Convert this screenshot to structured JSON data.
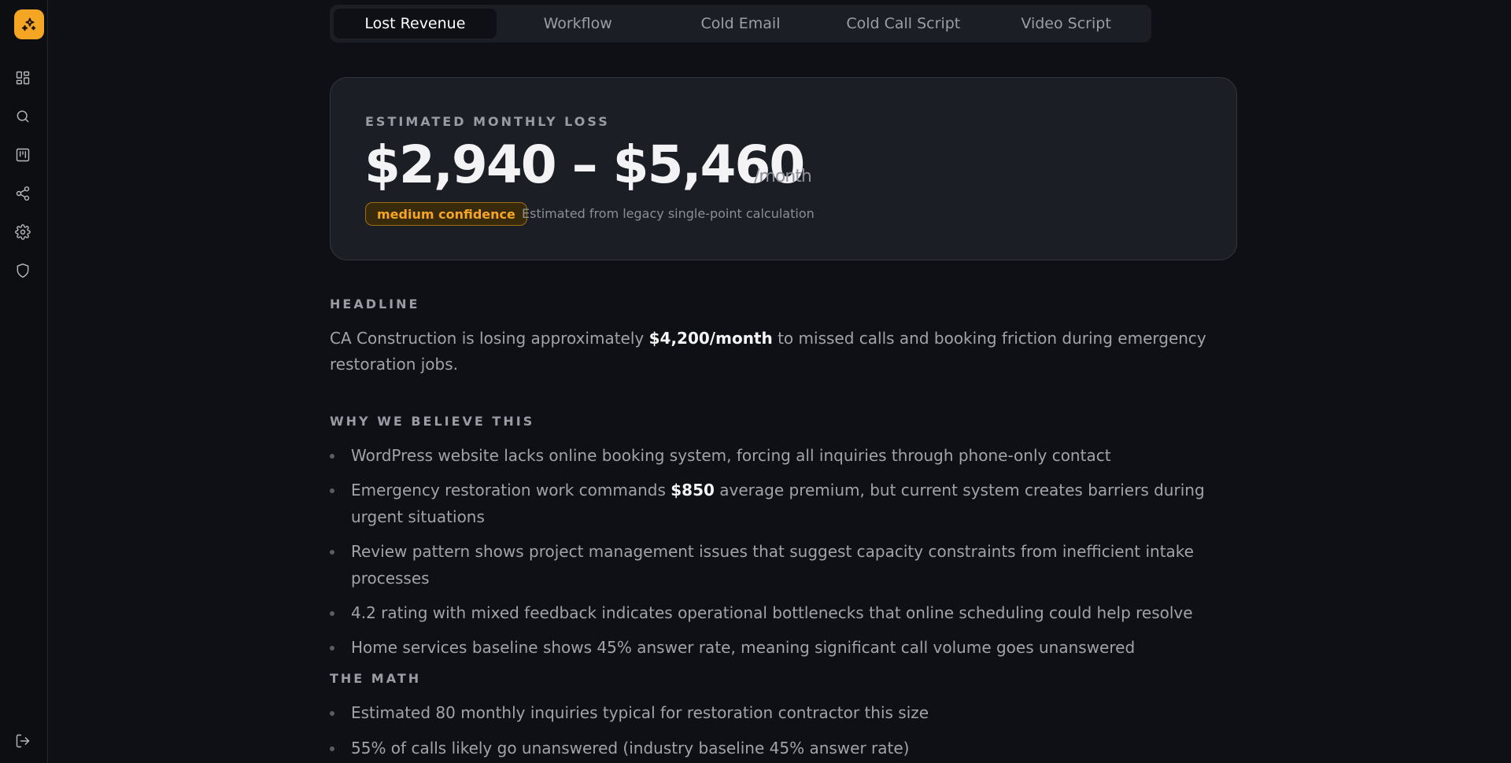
{
  "sidebar": {
    "logo": "sparkles-logo",
    "items": [
      {
        "icon": "dashboard-icon"
      },
      {
        "icon": "search-icon"
      },
      {
        "icon": "kanban-icon"
      },
      {
        "icon": "share-icon"
      },
      {
        "icon": "gear-icon"
      },
      {
        "icon": "shield-icon"
      }
    ],
    "logout_icon": "logout-icon"
  },
  "tabs": [
    {
      "label": "Lost Revenue",
      "active": true
    },
    {
      "label": "Workflow",
      "active": false
    },
    {
      "label": "Cold Email",
      "active": false
    },
    {
      "label": "Cold Call Script",
      "active": false
    },
    {
      "label": "Video Script",
      "active": false
    }
  ],
  "loss_card": {
    "label": "ESTIMATED MONTHLY LOSS",
    "amount": "$2,940 – $5,460",
    "unit": "/month",
    "badge": "medium confidence",
    "note": "Estimated from legacy single-point calculation"
  },
  "headline": {
    "heading": "HEADLINE",
    "text_before": "CA Construction is losing approximately ",
    "highlight": "$4,200/month",
    "text_after": " to missed calls and booking friction during emergency restoration jobs."
  },
  "why": {
    "heading": "WHY WE BELIEVE THIS",
    "items": [
      {
        "before": "WordPress website lacks online booking system, forcing all inquiries through phone-only contact",
        "bold": "",
        "after": ""
      },
      {
        "before": "Emergency restoration work commands ",
        "bold": "$850",
        "after": " average premium, but current system creates barriers during urgent situations"
      },
      {
        "before": "Review pattern shows project management issues that suggest capacity constraints from inefficient intake processes",
        "bold": "",
        "after": ""
      },
      {
        "before": "4.2 rating with mixed feedback indicates operational bottlenecks that online scheduling could help resolve",
        "bold": "",
        "after": ""
      },
      {
        "before": "Home services baseline shows 45% answer rate, meaning significant call volume goes unanswered",
        "bold": "",
        "after": ""
      }
    ]
  },
  "math": {
    "heading": "THE MATH",
    "items": [
      {
        "before": "Estimated 80 monthly inquiries typical for restoration contractor this size",
        "bold": "",
        "after": ""
      },
      {
        "before": "55% of calls likely go unanswered (industry baseline 45% answer rate)",
        "bold": "",
        "after": ""
      }
    ]
  },
  "colors": {
    "accent": "#f5a524",
    "background": "#0f1015",
    "card": "#1c1e25"
  }
}
